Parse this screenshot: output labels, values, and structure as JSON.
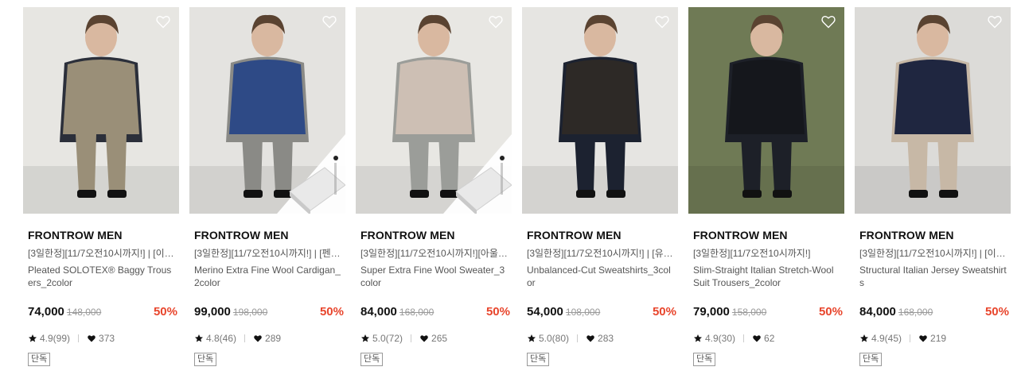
{
  "products": [
    {
      "brand": "FRONTROW MEN",
      "promo": "[3일한정][11/7오전10시까지!] | [이동…",
      "name": "Pleated SOLOTEX® Baggy Trousers_2color",
      "price": "74,000",
      "original_price": "148,000",
      "discount": "50%",
      "rating": "4.9(99)",
      "likes": "373",
      "badge": "단독",
      "photo": {
        "bg": "#e7e6e2",
        "garment": "#9a8f78",
        "top": "#2b2f3a",
        "package": false
      }
    },
    {
      "brand": "FRONTROW MEN",
      "promo": "[3일한정][11/7오전10시까지!] | [펜트…",
      "name": "Merino Extra Fine Wool Cardigan_2color",
      "price": "99,000",
      "original_price": "198,000",
      "discount": "50%",
      "rating": "4.8(46)",
      "likes": "289",
      "badge": "단독",
      "photo": {
        "bg": "#e4e3e0",
        "garment": "#2e4a86",
        "top": "#8a8a86",
        "package": true
      }
    },
    {
      "brand": "FRONTROW MEN",
      "promo": "[3일한정][11/7오전10시까지!][아울렛…",
      "name": "Super Extra Fine Wool Sweater_3color",
      "price": "84,000",
      "original_price": "168,000",
      "discount": "50%",
      "rating": "5.0(72)",
      "likes": "265",
      "badge": "단독",
      "photo": {
        "bg": "#e8e7e3",
        "garment": "#cdbfb4",
        "top": "#9b9d99",
        "package": true
      }
    },
    {
      "brand": "FRONTROW MEN",
      "promo": "[3일한정][11/7오전10시까지!] | [유준…",
      "name": "Unbalanced-Cut Sweatshirts_3color",
      "price": "54,000",
      "original_price": "108,000",
      "discount": "50%",
      "rating": "5.0(80)",
      "likes": "283",
      "badge": "단독",
      "photo": {
        "bg": "#e6e5e2",
        "garment": "#2d2926",
        "top": "#1c2230",
        "package": false
      }
    },
    {
      "brand": "FRONTROW MEN",
      "promo": "[3일한정][11/7오전10시까지!]",
      "name": "Slim-Straight Italian Stretch-Wool Suit Trousers_2color",
      "price": "79,000",
      "original_price": "158,000",
      "discount": "50%",
      "rating": "4.9(30)",
      "likes": "62",
      "badge": "단독",
      "photo": {
        "bg": "#6f7a55",
        "garment": "#15171c",
        "top": "#1d2028",
        "package": false
      }
    },
    {
      "brand": "FRONTROW MEN",
      "promo": "[3일한정][11/7오전10시까지!] | [이신…",
      "name": "Structural Italian Jersey Sweatshirts",
      "price": "84,000",
      "original_price": "168,000",
      "discount": "50%",
      "rating": "4.9(45)",
      "likes": "219",
      "badge": "단독",
      "photo": {
        "bg": "#dcdbd8",
        "garment": "#1f2640",
        "top": "#c7b8a6",
        "package": false
      }
    }
  ],
  "colors": {
    "discount": "#e8452c",
    "price": "#111111"
  }
}
